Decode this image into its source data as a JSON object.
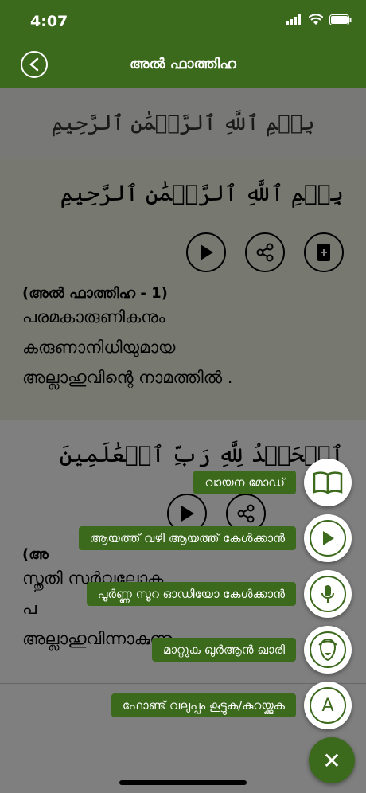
{
  "status_bar": {
    "time": "4:07"
  },
  "header": {
    "title": "അൽ ഫാത്തിഹ"
  },
  "banner": {
    "arabic": "بِسۡمِ ٱللَّهِ ٱلرَّحۡمَٰنِ ٱلرَّحِيمِ"
  },
  "verses": [
    {
      "arabic": "بِسۡمِ ٱللَّهِ ٱلرَّحۡمَٰنِ ٱلرَّحِيمِ",
      "reference": "(അൽ ഫാത്തിഹ - 1)",
      "translation_lines": [
        "പരമകാരുണികനും",
        "കരുണാനിധിയുമായ",
        "അല്ലാഹുവിന്റെ നാമത്തിൽ ."
      ]
    },
    {
      "arabic": "ٱلۡحَمۡدُ لِلَّهِ رَبِّ ٱلۡعَٰلَمِينَ",
      "reference": "(അ",
      "translation_lines": [
        "സ്തുതി സർവ്വലോക",
        "പ",
        "അല്ലാഹുവിന്നാകുന്നു."
      ]
    }
  ],
  "fab_menu": {
    "reading_mode": "വായന മോഡ്",
    "ayah_by_ayah": "ആയത്ത് വഴി ആയത്ത് കേൾക്കാൻ",
    "full_surah_audio": "പൂർണ്ണ സൂറ ഓഡിയോ കേൾക്കാൻ",
    "change_reciter": "മാറ്റുക ഖുർആൻ ഖാരി",
    "font_size": "ഫോണ്ട് വലുപ്പം കൂട്ടുക/കുറയ്ക്കുക",
    "font_icon_letter": "A",
    "close_symbol": "✕"
  },
  "colors": {
    "brand": "#3c6a1d",
    "verse_highlight": "#eef3e3"
  }
}
